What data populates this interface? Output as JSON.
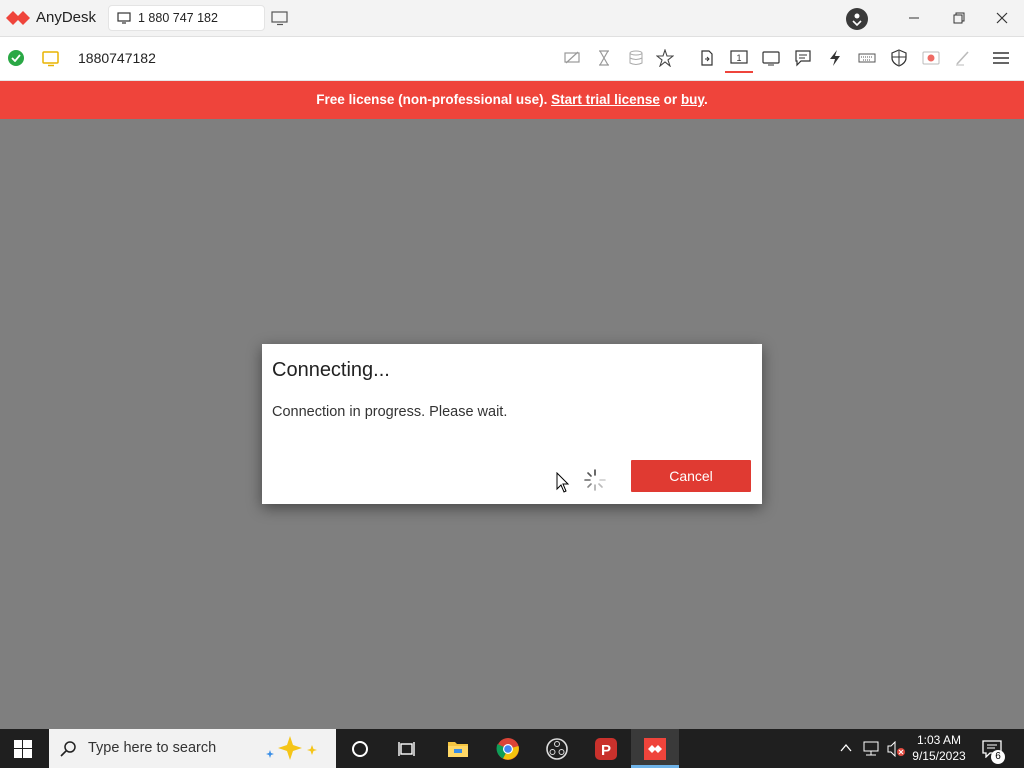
{
  "app": {
    "name": "AnyDesk"
  },
  "tab": {
    "label": "1 880 747 182"
  },
  "toolbar": {
    "address": "1880747182"
  },
  "banner": {
    "prefix": "Free license (non-professional use). ",
    "trial_link": "Start trial license",
    "middle": " or ",
    "buy_link": "buy",
    "suffix": "."
  },
  "dialog": {
    "title": "Connecting...",
    "message": "Connection in progress. Please wait.",
    "cancel_label": "Cancel"
  },
  "taskbar": {
    "search_placeholder": "Type here to search",
    "time": "1:03 AM",
    "date": "9/15/2023",
    "notification_count": "6"
  },
  "colors": {
    "accent": "#ef443b",
    "remote_bg": "#7f7f7f",
    "status_ok": "#2aa845",
    "taskbar": "#1f1f1f"
  },
  "icons": [
    "anydesk-logo-icon",
    "monitor-icon",
    "new-tab-icon",
    "account-icon",
    "minimize-icon",
    "restore-icon",
    "close-icon",
    "connection-ok-icon",
    "hide-screen-icon",
    "hourglass-icon",
    "database-icon",
    "star-icon",
    "file-transfer-icon",
    "monitor-1-icon",
    "display-icon",
    "chat-icon",
    "lightning-icon",
    "keyboard-icon",
    "shield-icon",
    "record-icon",
    "pen-icon",
    "menu-icon",
    "windows-start-icon",
    "search-icon",
    "cortana-icon",
    "task-view-icon",
    "explorer-icon",
    "chrome-icon",
    "obs-icon",
    "psiphon-icon",
    "anydesk-taskbar-icon",
    "chevron-up-icon",
    "network-icon",
    "volume-muted-icon",
    "notification-icon"
  ]
}
